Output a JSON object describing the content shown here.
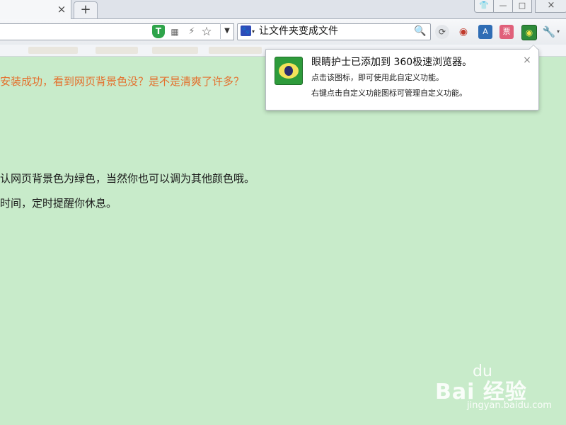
{
  "tabs": {
    "close_glyph": "×",
    "new_tab_glyph": "+"
  },
  "window_controls": {
    "skin": "👕",
    "minimize": "—",
    "maximize": "□",
    "close": "×"
  },
  "toolbar": {
    "shield_label": "T",
    "qrcode_glyph": "▦",
    "flash_glyph": "⚡",
    "star_glyph": "☆",
    "dropdown_glyph": "▼"
  },
  "search": {
    "engine_glyph": "🐾",
    "caret": "▾",
    "query": "让文件夹变成文件",
    "button_glyph": "🔍"
  },
  "extensions": {
    "refresh_glyph": "⟳",
    "eye_glyph": "◉",
    "translate_glyph": "A",
    "ticket_glyph": "票",
    "eyecare_glyph": "◉",
    "tools_glyph": "🔧",
    "tools_caret": "▾"
  },
  "content": {
    "line1": "安装成功，看到网页背景色没？是不是清爽了许多？",
    "line2": "认网页背景色为绿色，当然你也可以调为其他颜色哦。",
    "line3": "时间，定时提醒你休息。"
  },
  "notification": {
    "title": "眼睛护士已添加到 360极速浏览器。",
    "line1": "点击该图标，即可使用此自定义功能。",
    "line2": "右键点击自定义功能图标可管理自定义功能。",
    "close_glyph": "×"
  },
  "watermark": {
    "logo": "Bai  经验",
    "paw": "du",
    "url": "jingyan.baidu.com"
  },
  "colors": {
    "page_background": "#c8ebca",
    "highlight_text": "#e4702d"
  }
}
